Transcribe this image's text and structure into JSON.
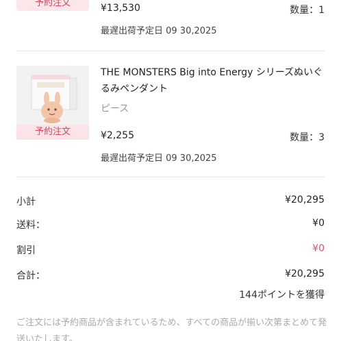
{
  "item1": {
    "badge": "予約注文",
    "price": "¥13,530",
    "quantity": "数量：1",
    "eta": "最遅出荷予定日 09 30,2025"
  },
  "item2": {
    "badge": "予約注文",
    "name": "THE MONSTERS Big into Energy シリーズぬいぐるみペンダント",
    "variant": "ピース",
    "price": "¥2,255",
    "quantity": "数量：3",
    "eta": "最遅出荷予定日 09 30,2025"
  },
  "summary": {
    "subtotal_label": "小計",
    "subtotal_value": "¥20,295",
    "shipping_label": "送料：",
    "shipping_value": "¥0",
    "discount_label": "割引",
    "discount_value": "¥0",
    "total_label": "合計：",
    "total_value": "¥20,295",
    "points": "144ポイントを獲得"
  },
  "note": "ご注文には予約商品が含まれているため、すべての商品が揃い次第まとめて発送いたします。",
  "colors": {
    "badge_bg": "#fbe3e8",
    "badge_text": "#d9435c",
    "discount": "#d9566f"
  }
}
